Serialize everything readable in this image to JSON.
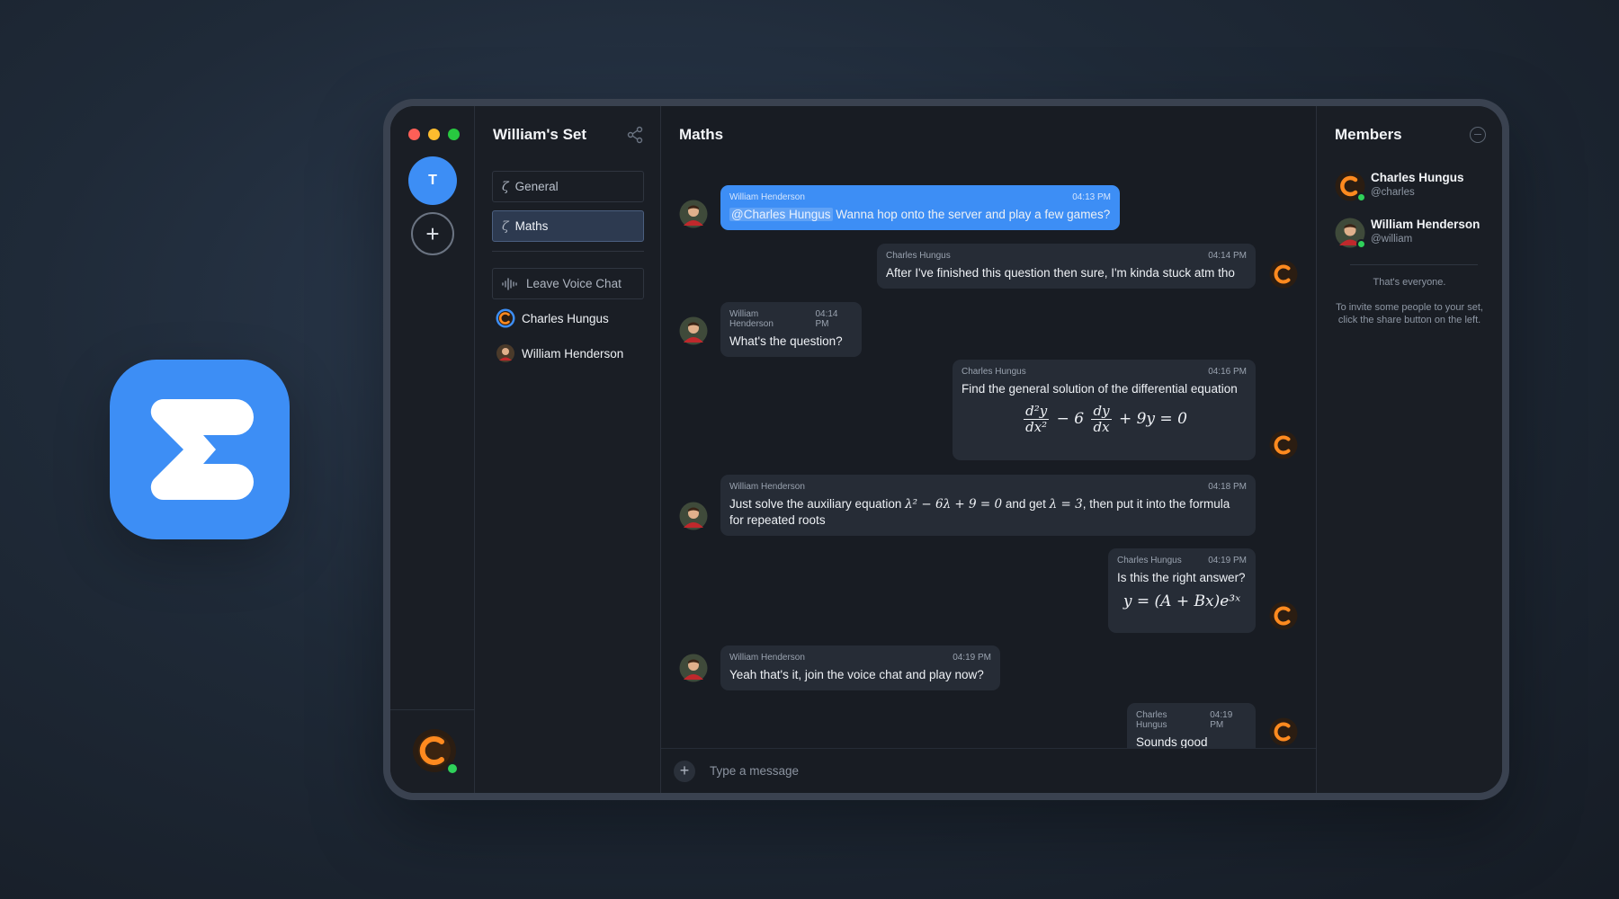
{
  "colors": {
    "accent": "#3d8ef5",
    "online": "#2fd15a",
    "charles_orange": "#ff8a1f"
  },
  "window": {
    "traffic_lights": [
      "close",
      "minimize",
      "maximize"
    ]
  },
  "rail": {
    "server_initial": "T",
    "add_icon": "plus-icon"
  },
  "server": {
    "name": "William's Set"
  },
  "channels": {
    "items": [
      {
        "label": "General",
        "glyph": "ζ"
      },
      {
        "label": "Maths",
        "glyph": "ζ",
        "active": true
      }
    ],
    "voice_button": "Leave Voice Chat",
    "voice_users": [
      {
        "name": "Charles Hungus"
      },
      {
        "name": "William Henderson"
      }
    ]
  },
  "chat": {
    "title": "Maths",
    "composer_placeholder": "Type a message",
    "messages": [
      {
        "author": "William Henderson",
        "time": "04:13 PM",
        "mention": "@Charles Hungus",
        "text": " Wanna hop onto the server and play a few games?"
      },
      {
        "author": "Charles Hungus",
        "time": "04:14 PM",
        "text": "After I've finished this question then sure, I'm kinda stuck atm tho"
      },
      {
        "author": "William Henderson",
        "time": "04:14 PM",
        "text": "What's the question?"
      },
      {
        "author": "Charles Hungus",
        "time": "04:16 PM",
        "text": "Find the general solution of the differential equation",
        "formula": {
          "num1": "d²y",
          "den1": "dx²",
          "mid": "− 6",
          "num2": "dy",
          "den2": "dx",
          "tail": "+ 9y = 0"
        }
      },
      {
        "author": "William Henderson",
        "time": "04:18 PM",
        "text_a": "Just solve the auxiliary equation ",
        "math_a": "λ² − 6λ + 9 = 0",
        "text_b": " and get ",
        "math_b": "λ = 3",
        "text_c": ", then put it into the formula for repeated roots"
      },
      {
        "author": "Charles Hungus",
        "time": "04:19 PM",
        "text": "Is this the right answer?",
        "formula": "y = (A + Bx)e³ˣ"
      },
      {
        "author": "William Henderson",
        "time": "04:19 PM",
        "text": "Yeah that's it, join the voice chat and play now?"
      },
      {
        "author": "Charles Hungus",
        "time": "04:19 PM",
        "text": "Sounds good"
      }
    ]
  },
  "members": {
    "title": "Members",
    "list": [
      {
        "name": "Charles Hungus",
        "handle": "@charles",
        "status": "online"
      },
      {
        "name": "William Henderson",
        "handle": "@william",
        "status": "online"
      }
    ],
    "everyone_note": "That's everyone.",
    "invite_note": "To invite some people to your set, click the share button on the left."
  }
}
